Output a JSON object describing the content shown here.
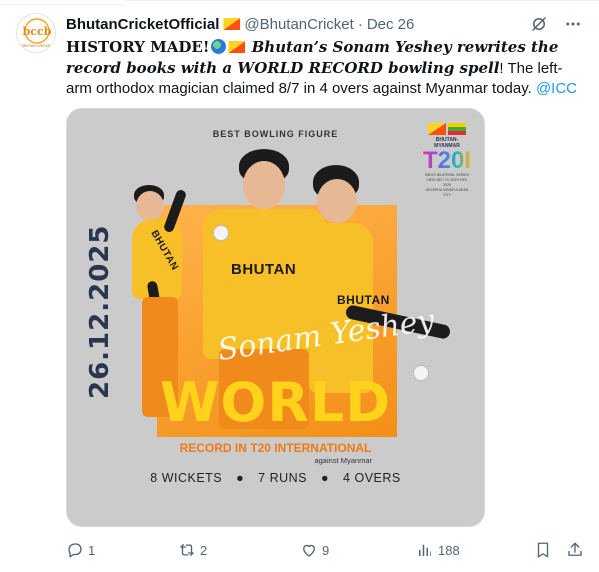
{
  "tweet": {
    "display_name": "BhutanCricketOfficial",
    "handle": "@BhutanCricket",
    "separator": "·",
    "date": "Dec 26",
    "text": {
      "part1": "HISTORY MADE!",
      "part2": "Bhutan’s Sonam Yeshey rewrites the record books with a WORLD RECORD bowling spell",
      "part3": "! The left-arm orthodox magician claimed 8/7 in 4 overs against Myanmar today.",
      "mention": "@ICC"
    },
    "emojis": [
      "globe-emoji",
      "bhutan-flag-emoji"
    ]
  },
  "avatar": {
    "logo_text": "bccb",
    "caption": "BHUTAN CRICKET"
  },
  "poster": {
    "title": "BEST BOWLING FIGURE",
    "date": "26.12.2025",
    "player_name": "Sonam Yeshey",
    "headline": "WORLD",
    "record_line": "RECORD IN T20 INTERNATIONAL",
    "against": "against Myanmar",
    "stats": [
      "8 WICKETS",
      "7 RUNS",
      "4 OVERS"
    ],
    "stat_separator": "●",
    "jersey_text": "BHUTAN",
    "series_logo": {
      "top": "BHUTAN-MYANMAR",
      "big": "T20I",
      "line1": "MEN'S BILATERAL SERIES",
      "line2": "23RD DEC TO 29TH DEC 2025",
      "line3": "GELEPHU MINDFULNESS CITY"
    }
  },
  "actions": {
    "reply_count": "1",
    "retweet_count": "2",
    "like_count": "9",
    "views_count": "188"
  },
  "colors": {
    "link": "#1d9bf0",
    "muted": "#536471",
    "poster_bg": "#cbcbcb",
    "orange": "#f38f17",
    "world_yellow": "#ffd21c",
    "date_navy": "#2a3650"
  }
}
